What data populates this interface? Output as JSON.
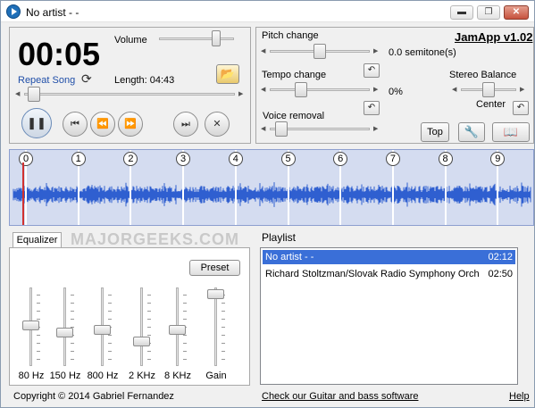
{
  "window": {
    "title": "No artist - -",
    "min_glyph": "▬",
    "max_glyph": "❐",
    "close_glyph": "✕"
  },
  "player": {
    "time": "00:05",
    "volume_label": "Volume",
    "volume_level": 0.8,
    "repeat_label": "Repeat Song",
    "length_label": "Length: 04:43",
    "position_level": 0.02,
    "pause_glyph": "❚❚",
    "prev_glyph": "⏮",
    "rewind_glyph": "⏪",
    "forward_glyph": "⏩",
    "next_glyph": "⏭",
    "stop_glyph": "✕",
    "open_glyph": "📂",
    "repeat_glyph": "⟳"
  },
  "effects": {
    "app_title": "JamApp v1.02",
    "pitch_label": "Pitch change",
    "pitch_value": "0.0 semitone(s)",
    "tempo_label": "Tempo change",
    "tempo_value": "0%",
    "voice_label": "Voice removal",
    "balance_label": "Stereo Balance",
    "balance_value": "Center",
    "top_button": "Top",
    "reset_glyph": "↶"
  },
  "waveform": {
    "markers": [
      "0",
      "1",
      "2",
      "3",
      "4",
      "5",
      "6",
      "7",
      "8",
      "9"
    ]
  },
  "watermark": "MAJORGEEKS.COM",
  "equalizer": {
    "tab_label": "Equalizer",
    "preset_button": "Preset",
    "bands": [
      {
        "label": "80 Hz",
        "level": 0.52
      },
      {
        "label": "150 Hz",
        "level": 0.42
      },
      {
        "label": "800 Hz",
        "level": 0.46
      },
      {
        "label": "2 KHz",
        "level": 0.28
      },
      {
        "label": "8 KHz",
        "level": 0.46
      },
      {
        "label": "Gain",
        "level": 0.98
      }
    ]
  },
  "playlist": {
    "heading": "Playlist",
    "items": [
      {
        "name": "No artist - -",
        "time": "02:12",
        "selected": true
      },
      {
        "name": "Richard Stoltzman/Slovak Radio Symphony Orch",
        "time": "02:50",
        "selected": false
      }
    ]
  },
  "footer": {
    "copyright": "Copyright © 2014 Gabriel Fernandez",
    "promo_link": "Check our Guitar and bass software",
    "help_link": "Help"
  },
  "colors": {
    "accent": "#1f6fb8",
    "wave_bg": "#d4dcf0",
    "wave_fg": "#2f5fd0",
    "selection": "#3a6fd8"
  }
}
